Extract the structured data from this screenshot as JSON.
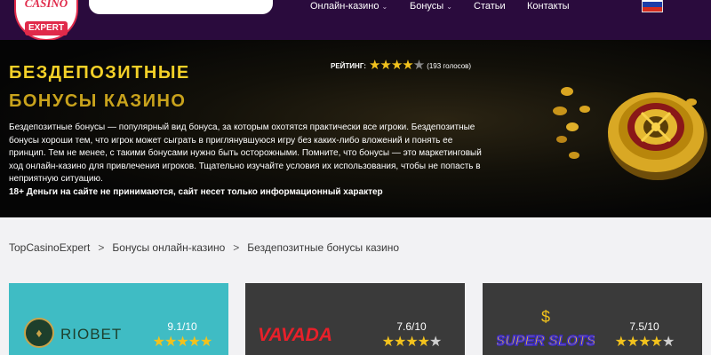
{
  "header": {
    "logo_top": "CASINO",
    "logo_bottom": "EXPERT",
    "search_placeholder": "",
    "nav": [
      {
        "label": "Онлайн-казино",
        "has_dropdown": true
      },
      {
        "label": "Бонусы",
        "has_dropdown": true
      },
      {
        "label": "Статьи",
        "has_dropdown": false
      },
      {
        "label": "Контакты",
        "has_dropdown": false
      }
    ],
    "language_flag": "russia-flag"
  },
  "hero": {
    "title_line1": "БЕЗДЕПОЗИТНЫЕ",
    "title_line2": "БОНУСЫ КАЗИНО",
    "rating_label": "РЕЙТИНГ:",
    "rating_stars": "★★★★",
    "rating_half": "★",
    "rating_value": 4.5,
    "rating_votes": "(193 голосов)",
    "paragraph": "Бездепозитные бонусы — популярный вид бонуса, за которым охотятся практически все игроки. Бездепозитные бонусы хороши тем, что игрок может сыграть в приглянувшуюся игру без каких-либо вложений и понять ее принцип. Тем не менее, с такими бонусами нужно быть осторожными. Помните, что бонусы — это маркетинговый ход онлайн-казино для привлечения игроков. Тщательно изучайте условия их использования, чтобы не попасть в неприятную ситуацию.",
    "disclaimer": "18+ Деньги на сайте не принимаются, сайт несет только информационный характер"
  },
  "breadcrumb": {
    "items": [
      "TopCasinoExpert",
      "Бонусы онлайн-казино",
      "Бездепозитные бонусы казино"
    ],
    "separator": ">"
  },
  "cards": [
    {
      "name": "RIOBET",
      "score": "9.1/10",
      "stars_on": "★★★★★",
      "stars_off": "",
      "stars_value": 5,
      "bg": "#3fbcc4"
    },
    {
      "name": "VAVADA",
      "score": "7.6/10",
      "stars_on": "★★★★",
      "stars_off": "★",
      "stars_value": 4,
      "bg": "#3a3a3a"
    },
    {
      "name": "SUPER SLOTS",
      "score": "7.5/10",
      "stars_on": "★★★★",
      "stars_off": "★",
      "stars_value": 4,
      "bg": "#3a3a3a"
    }
  ],
  "colors": {
    "header_bg": "#2a0b3d",
    "accent_gold": "#f3d028",
    "star": "#f2c21d"
  }
}
